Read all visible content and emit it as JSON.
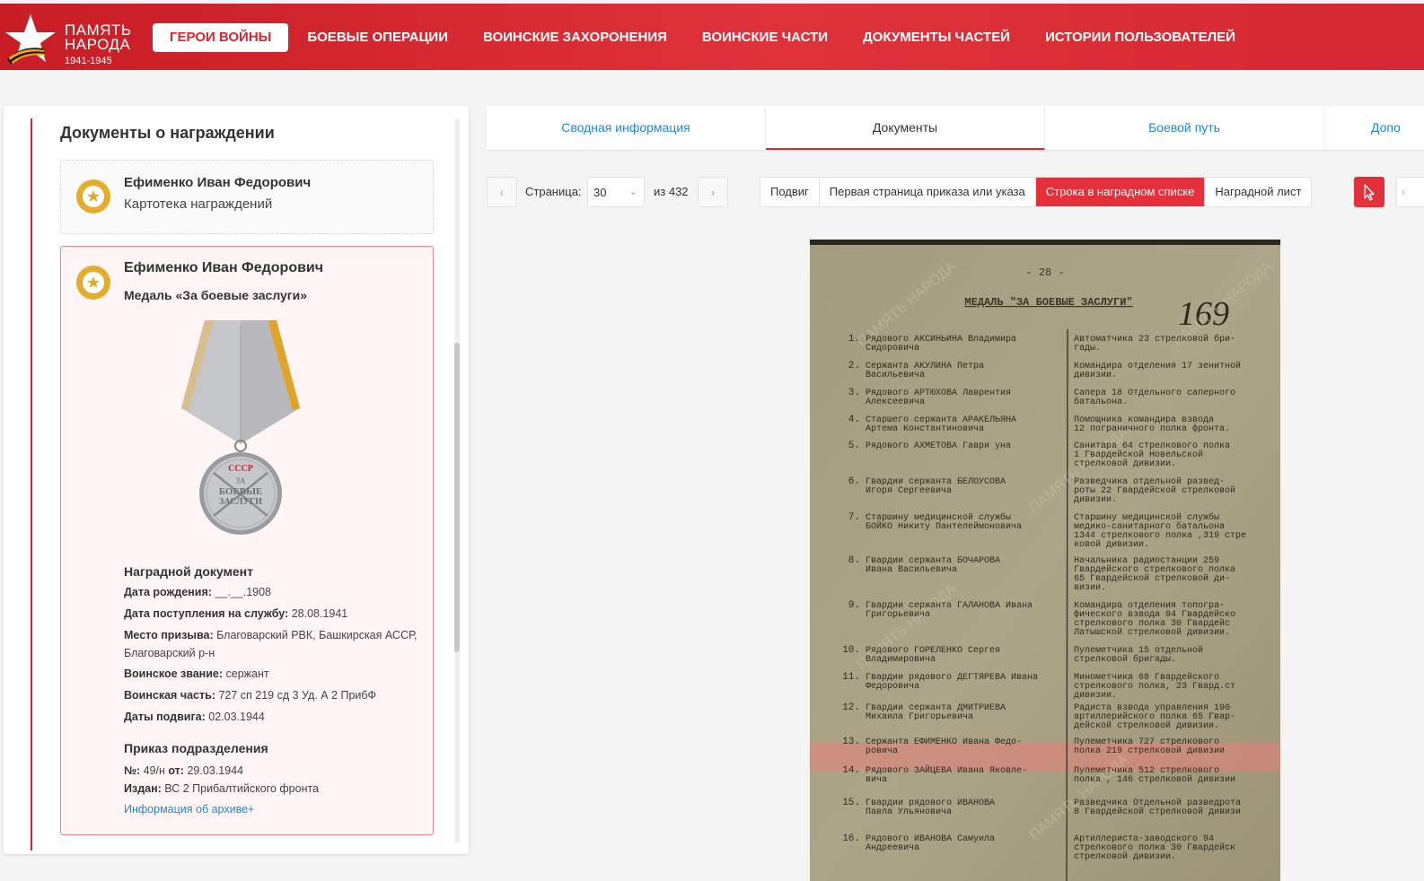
{
  "header": {
    "logo_line1": "ПАМЯТЬ",
    "logo_line2": "НАРОДА",
    "logo_years": "1941-1945",
    "nav": [
      "ГЕРОИ ВОЙНЫ",
      "БОЕВЫЕ ОПЕРАЦИИ",
      "ВОИНСКИЕ ЗАХОРОНЕНИЯ",
      "ВОИНСКИЕ ЧАСТИ",
      "ДОКУМЕНТЫ ЧАСТЕЙ",
      "ИСТОРИИ ПОЛЬЗОВАТЕЛЕЙ"
    ],
    "accent": "#d42832"
  },
  "left": {
    "title": "Документы о награждении",
    "card1": {
      "name": "Ефименко Иван Федорович",
      "subtitle": "Картотека награждений"
    },
    "card2": {
      "name": "Ефименко Иван Федорович",
      "subtitle": "Медаль «За боевые заслуги»",
      "medal_texts": [
        "СССР",
        "ЗА",
        "БОЕВЫЕ",
        "ЗАСЛУГИ"
      ],
      "doc_section": "Наградной документ",
      "fields": [
        {
          "label": "Дата рождения:",
          "value": "__.__.1908"
        },
        {
          "label": "Дата поступления на службу:",
          "value": "28.08.1941"
        },
        {
          "label": "Место призыва:",
          "value": "Благоварский РВК, Башкирская АССР, Благоварский р-н"
        },
        {
          "label": "Воинское звание:",
          "value": "сержант"
        },
        {
          "label": "Воинская часть:",
          "value": "727 сп 219 сд 3 Уд. А 2 ПрибФ"
        },
        {
          "label": "Даты подвига:",
          "value": "02.03.1944"
        }
      ],
      "order_section": "Приказ подразделения",
      "order_no_label": "№:",
      "order_no": "49/н",
      "order_from_label": "от:",
      "order_date": "29.03.1944",
      "issued_label": "Издан:",
      "issued_by": "ВС 2 Прибалтийского фронта",
      "archive_link": "Информация об архиве+"
    }
  },
  "tabs": [
    "Сводная информация",
    "Документы",
    "Боевой путь",
    "Допо"
  ],
  "toolbar": {
    "prev": "‹",
    "next": "›",
    "page_label": "Страница:",
    "page_value": "30",
    "of_label": "из 432",
    "segments": [
      "Подвиг",
      "Первая страница приказа или указа",
      "Строка в наградном списке",
      "Наградной лист"
    ],
    "active_segment": "Строка в наградном списке"
  },
  "document": {
    "page_no": "- 28 -",
    "heading": "МЕДАЛЬ \"ЗА БОЕВЫЕ ЗАСЛУГИ\"",
    "handwritten": "169",
    "watermark": "ПАМЯТЬ НАРОДА",
    "rows": [
      {
        "n": "1.",
        "left": [
          "Рядового АКСИНЬИНА Владимира",
          "Сидоровича"
        ],
        "right": [
          "Автоматчика 23 стрелковой бри-",
          "гады."
        ]
      },
      {
        "n": "2.",
        "left": [
          "Сержанта АКУЛИНА Петра",
          "Васильевича"
        ],
        "right": [
          "Командира отделения 17 зенитной",
          "дивизии."
        ]
      },
      {
        "n": "3.",
        "left": [
          "Рядового АРТЮХОВА Лаврентия",
          "Алексеевича"
        ],
        "right": [
          "Сапера 18 Отдельного саперного",
          "батальона."
        ]
      },
      {
        "n": "4.",
        "left": [
          "Старшего сержанта АРАКЕЛЬЯНА",
          "Артема Константиновича"
        ],
        "right": [
          "Помощника командира взвода",
          "12 пограничного полка фронта."
        ]
      },
      {
        "n": "5.",
        "left": [
          "Рядового АХМЕТОВА  Гаври уна",
          ""
        ],
        "right": [
          "Санитара 64 стрелкового полка",
          "1 Гвардейской Новельской",
          "стрелковой дивизии."
        ]
      },
      {
        "n": "6.",
        "left": [
          "Гвардии сержанта БЕЛОУСОВА",
          "Игоря Сергеевича"
        ],
        "right": [
          "Разведчика отдельной развед-",
          "роты 22 Гвардейской стрелковой",
          "дивизии."
        ]
      },
      {
        "n": "7.",
        "left": [
          "Старшину медицинской службы",
          "БОЙКО Никиту Пантелеймоновича"
        ],
        "right": [
          "Старшину медицинской службы",
          "медико-санитарного батальона",
          "1344 стрелкового полка ,319 стре",
          "ковой дивизии."
        ]
      },
      {
        "n": "8.",
        "left": [
          "Гвардии сержанта БОЧАРОВА",
          "Ивана Васильевича"
        ],
        "right": [
          "Начальника радиостанции 259",
          "Гвардейского стрелкового полка",
          "65 Гвардейской стрелковой ди-",
          "визии."
        ]
      },
      {
        "n": "9.",
        "left": [
          "Гвардии сержанта ГАЛАНОВА Ивана",
          "Григорьевича"
        ],
        "right": [
          "Командира отделения топогра-",
          "фического взвода 94 Гвардейско",
          "стрелкового полка 30 Гвардейс",
          "Латышской стрелковой дивизии."
        ]
      },
      {
        "n": "10.",
        "left": [
          "Рядового ГОРЕЛЕНКО Сергея",
          "Владимировича"
        ],
        "right": [
          "Пулеметчика 15 отдельной",
          "стрелковой бригады."
        ]
      },
      {
        "n": "11.",
        "left": [
          "Гвардии рядового ДЕГТЯРЕВА Ивана",
          "Федоровича"
        ],
        "right": [
          "Минометчика 68 Гвардейского",
          "стрелкового полка, 23 Гвард.ст",
          "дивизии."
        ]
      },
      {
        "n": "12.",
        "left": [
          "Гвардии сержанта ДМИТРИЕВА",
          "Михаила Григорьевича"
        ],
        "right": [
          "Радиста взвода управления 190",
          "артиллерийского полка 65 Гвар-",
          "дейской стрелковой дивизии."
        ]
      },
      {
        "n": "13.",
        "left": [
          "Сержанта ЕФИМЕНКО Ивана Федо-",
          "ровича"
        ],
        "right": [
          "Пулеметчика 727 стрелкового",
          "полка 219 стрелковой дивизии"
        ],
        "highlight": true
      },
      {
        "n": "14.",
        "left": [
          "Рядового ЗАЙЦЕВА Ивана Яковле-",
          "вича"
        ],
        "right": [
          "Пулеметчика 512 стрелкового",
          "полка , 146 стрелковой дивизии"
        ]
      },
      {
        "n": "15.",
        "left": [
          "Гвардии рядового ИВАНОВА",
          "Павла Ульяновича"
        ],
        "right": [
          "Разведчика Отдельной разведрота",
          "8 Гвардейской стрелковой дивизи"
        ]
      },
      {
        "n": "16.",
        "left": [
          "Рядового ИВАНОВА Самуила",
          "Андреевича"
        ],
        "right": [
          "Артиллериста-заводского 94",
          "стрелкового полка 30 Гвардейск",
          "стрелковой дивизии."
        ]
      }
    ]
  }
}
